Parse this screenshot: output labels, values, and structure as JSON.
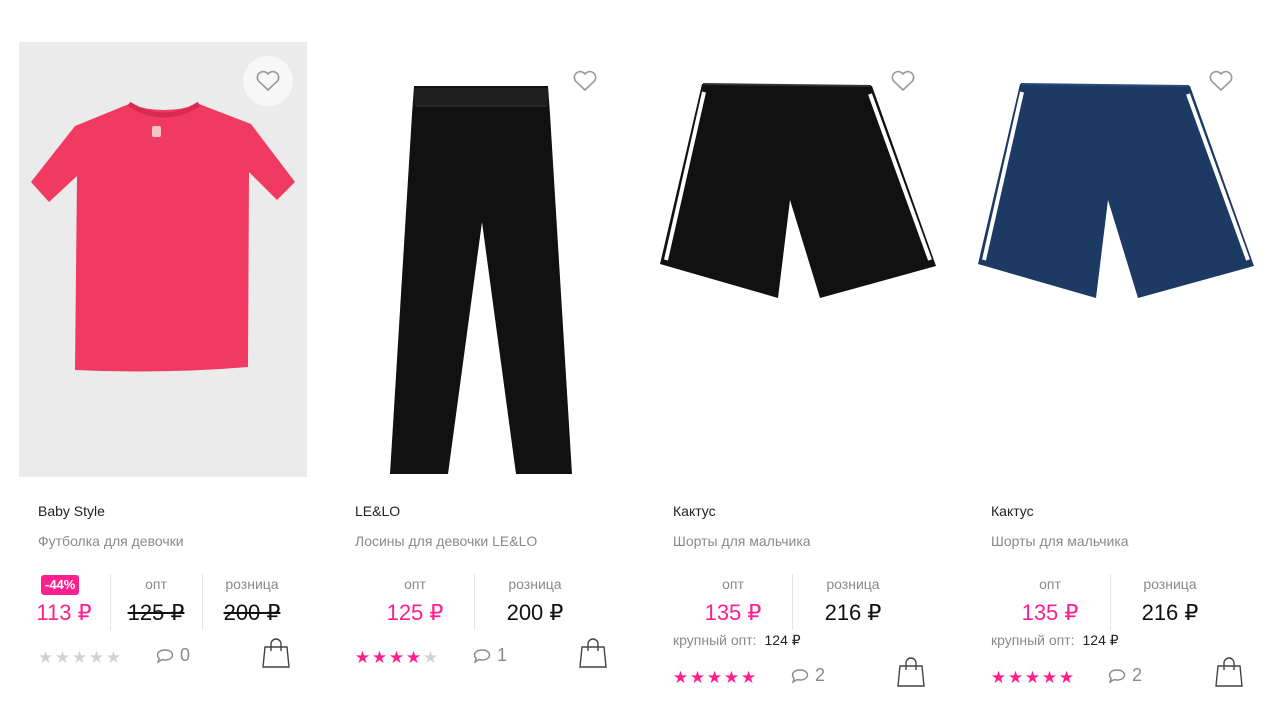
{
  "labels": {
    "opt": "опт",
    "retail": "розница",
    "bulk_opt": "крупный опт:"
  },
  "colors": {
    "accent": "#ff1f8e",
    "muted": "#8a8a8a",
    "star_empty": "#d2d2d2"
  },
  "products": [
    {
      "brand": "Baby Style",
      "title": "Футболка для девочки",
      "discount_badge": "-44%",
      "price_main": "113 ₽",
      "price_opt": "125 ₽",
      "price_retail": "200 ₽",
      "rating": 0,
      "comments": "0",
      "image_icon": "pink-tshirt-image"
    },
    {
      "brand": "LE&LO",
      "title": "Лосины для девочки LE&LO",
      "price_opt": "125 ₽",
      "price_retail": "200 ₽",
      "rating": 4,
      "comments": "1",
      "image_icon": "black-leggings-image"
    },
    {
      "brand": "Кактус",
      "title": "Шорты для мальчика",
      "price_opt": "135 ₽",
      "price_retail": "216 ₽",
      "bulk_price": "124 ₽",
      "rating": 5,
      "comments": "2",
      "image_icon": "black-shorts-image"
    },
    {
      "brand": "Кактус",
      "title": "Шорты для мальчика",
      "price_opt": "135 ₽",
      "price_retail": "216 ₽",
      "bulk_price": "124 ₽",
      "rating": 5,
      "comments": "2",
      "image_icon": "navy-shorts-image"
    }
  ]
}
